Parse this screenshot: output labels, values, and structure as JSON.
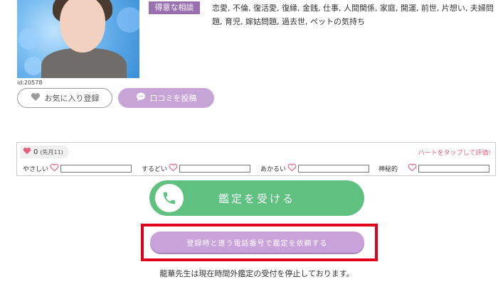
{
  "profile": {
    "id_label": "id:20578",
    "tag_label": "得意な相談",
    "specialties_text": "恋愛, 不倫, 復活愛, 復縁, 金銭, 仕事, 人間関係, 家庭, 開運, 前世, 片想い, 夫婦問題, 育児, 嫁姑問題, 過去世, ペットの気持ち"
  },
  "buttons": {
    "favorite_label": "お気に入り登録",
    "review_label": "口コミを投稿",
    "call_label": "鑑定を受ける",
    "other_phone_label": "登録時と違う電話番号で鑑定を依頼する"
  },
  "rating": {
    "count": "0",
    "period": "(先月11)",
    "hint": "ハートをタップして評価!",
    "items": [
      {
        "label": "やさしい",
        "level": 0
      },
      {
        "label": "するどい",
        "level": 0
      },
      {
        "label": "あかるい",
        "level": 0
      },
      {
        "label": "神秘的",
        "level": 0
      }
    ]
  },
  "notice": "龍華先生は現在時間外鑑定の受付を停止しております。",
  "colors": {
    "badge": "#9a6fb0",
    "review_button": "#c7a4d6",
    "call_button": "#5ec17f",
    "other_phone_button": "#c9a2d9",
    "highlight_border": "#e0001b",
    "heart": "#e0607e"
  },
  "icons": {
    "favorite": "heart-icon",
    "review": "speech-bubble-icon",
    "call": "phone-icon",
    "rating": "heart-outline-icon"
  }
}
